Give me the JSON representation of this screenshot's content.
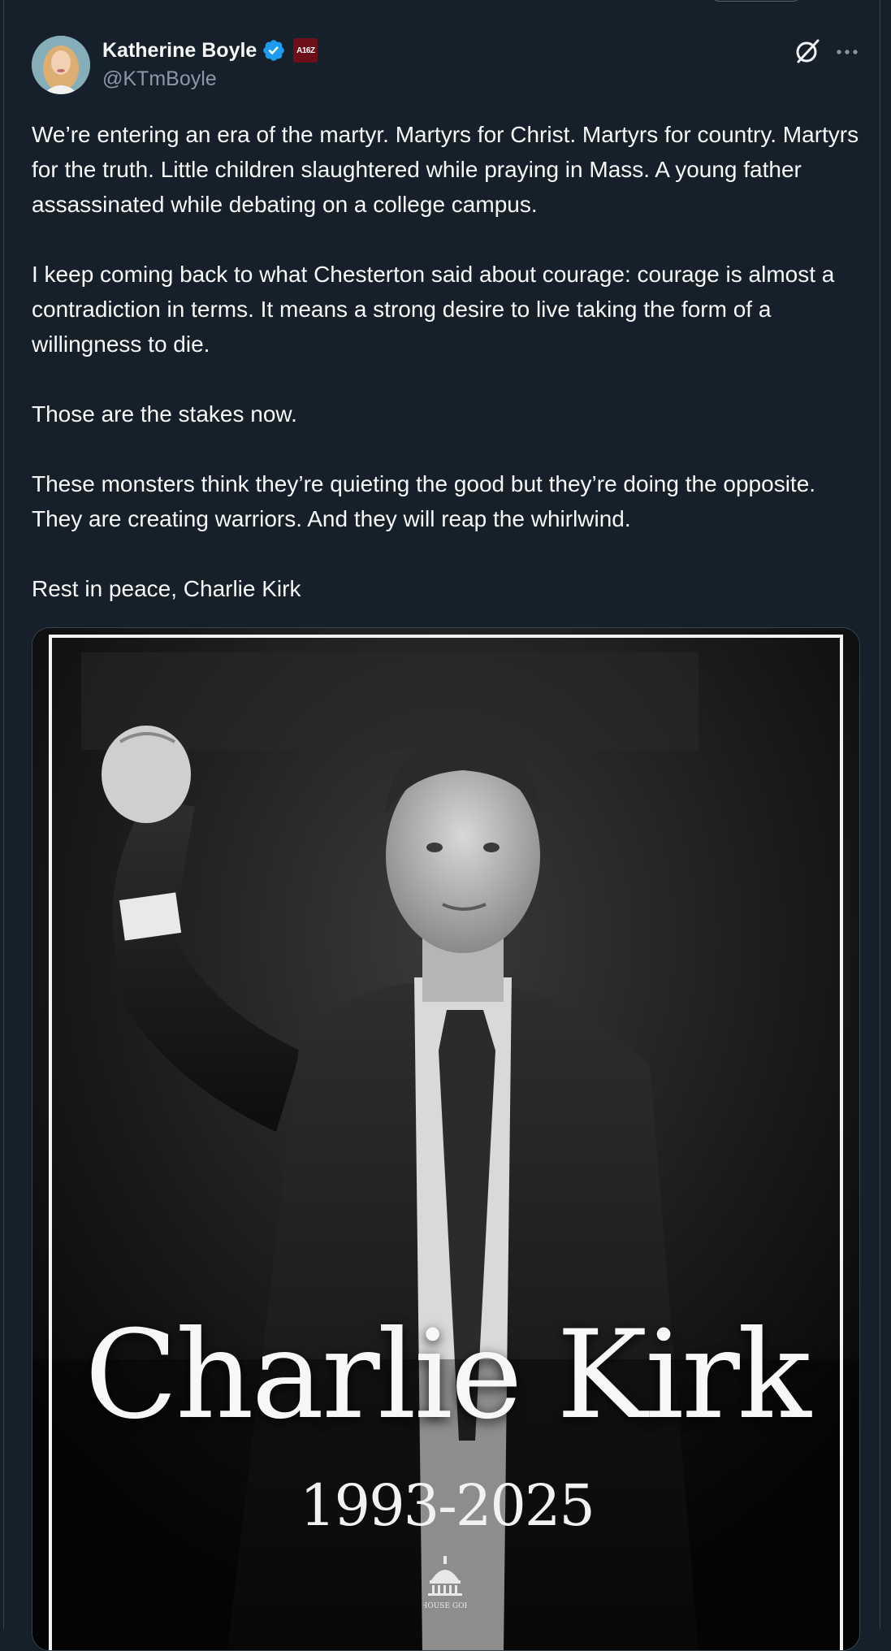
{
  "author": {
    "display_name": "Katherine Boyle",
    "handle": "@KTmBoyle",
    "verified": true,
    "affiliation_badge_text": "A16Z"
  },
  "icons": {
    "verified": "verified-badge-icon",
    "grok": "grok-icon",
    "more": "more-options-icon",
    "logo": "house-gop-capitol-logo"
  },
  "tweet": {
    "paragraphs": [
      "We’re entering an era of the martyr. Martyrs for Christ. Martyrs for country. Martyrs for the truth. Little children slaughtered while praying in Mass. A young father assassinated while debating on a college campus.",
      "I keep coming back to what Chesterton said about courage: courage is almost a contradiction in terms. It means a strong desire to live taking the form of a willingness to die.",
      "Those are the stakes now.",
      "These monsters think they’re quieting the good but they’re doing the opposite. They are creating warriors. And they will reap the whirlwind.",
      "Rest in peace, Charlie Kirk"
    ]
  },
  "media": {
    "memorial_name": "Charlie Kirk",
    "memorial_years": "1993-2025",
    "logo_text": "HOUSE GOP"
  },
  "colors": {
    "background": "#15202b",
    "text_primary": "#f7f9f9",
    "text_secondary": "#8b98a5",
    "verified_blue": "#1d9bf0",
    "badge_red": "#6d0f18"
  }
}
